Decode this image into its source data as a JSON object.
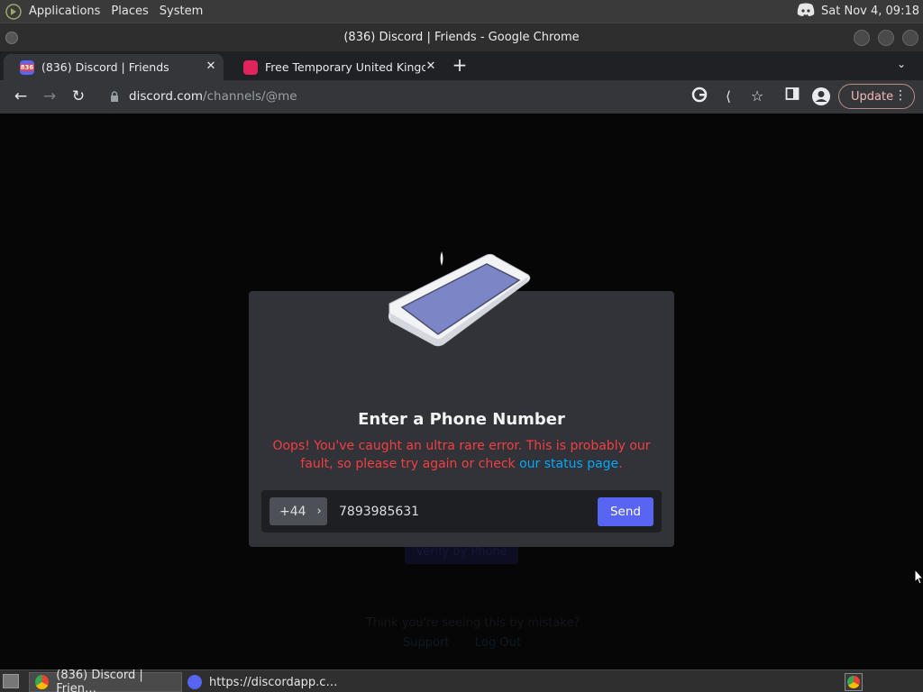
{
  "top_panel": {
    "menus": [
      "Applications",
      "Places",
      "System"
    ],
    "datetime": "Sat Nov  4, 09:18"
  },
  "window": {
    "title": "(836) Discord | Friends - Google Chrome"
  },
  "tabs": [
    {
      "label": "(836) Discord | Friends",
      "badge": "836",
      "favicon_color": "#ed4245"
    },
    {
      "label": "Free Temporary United Kingdom",
      "favicon_color": "#e0245e"
    }
  ],
  "address_bar": {
    "host": "discord.com",
    "path": "/channels/@me"
  },
  "toolbar": {
    "update_label": "Update"
  },
  "background": {
    "button_label": "Verify by Phone",
    "mistake_text": "Think you're seeing this by mistake?",
    "support_link": "Support",
    "logout_link": "Log Out"
  },
  "modal": {
    "title": "Enter a Phone Number",
    "error_text": "Oops! You've caught an ultra rare error. This is probably our fault, so please try again or check ",
    "error_link": "our status page",
    "error_end": ".",
    "country_code": "+44",
    "phone_value": "7893985631",
    "send_label": "Send"
  },
  "taskbar": {
    "items": [
      {
        "label": "(836) Discord | Frien…"
      },
      {
        "label": "https://discordapp.c…"
      }
    ]
  },
  "colors": {
    "discord_blurple": "#5865f2",
    "error_red": "#f23f43",
    "link_blue": "#00a8fc",
    "modal_bg": "#313338"
  }
}
